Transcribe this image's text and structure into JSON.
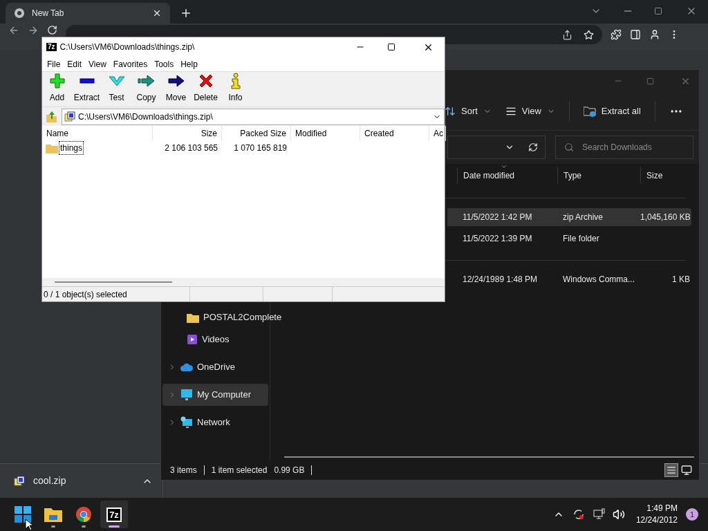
{
  "browser": {
    "tab": {
      "title": "New Tab"
    },
    "downloads": [
      {
        "name": "cool.zip"
      }
    ]
  },
  "explorer": {
    "toolbar": [
      {
        "label": "Sort",
        "kind": "sort"
      },
      {
        "label": "View",
        "kind": "view"
      },
      {
        "label": "Extract all",
        "kind": "extract"
      }
    ],
    "search": {
      "placeholder": "Search Downloads"
    },
    "columns": [
      "Date modified",
      "Type",
      "Size"
    ],
    "groups": [
      {
        "rows": [
          {
            "date": "11/5/2022 1:42 PM",
            "type": "zip Archive",
            "size": "1,045,160 KB",
            "selected": true
          },
          {
            "date": "11/5/2022 1:39 PM",
            "type": "File folder",
            "selected": false
          }
        ]
      },
      {
        "rows": [
          {
            "date": "12/24/1989 1:48 PM",
            "type": "Windows Comma...",
            "size": "1 KB",
            "selected": false
          }
        ]
      }
    ],
    "quick_access": [
      {
        "label": "POSTAL2Complete",
        "kind": "folder"
      },
      {
        "label": "Videos",
        "kind": "videos"
      }
    ],
    "locations": [
      {
        "label": "OneDrive",
        "kind": "cloud",
        "selected": false
      },
      {
        "label": "My Computer",
        "kind": "computer",
        "selected": true
      },
      {
        "label": "Network",
        "kind": "network",
        "selected": false
      }
    ],
    "status": {
      "count": "3 items",
      "selection": "1 item selected",
      "size": "0.99 GB"
    }
  },
  "sevenzip": {
    "badge": "7z",
    "title": "C:\\Users\\VM6\\Downloads\\things.zip\\",
    "menu": [
      "File",
      "Edit",
      "View",
      "Favorites",
      "Tools",
      "Help"
    ],
    "toolbar": [
      {
        "label": "Add",
        "kind": "add"
      },
      {
        "label": "Extract",
        "kind": "extract"
      },
      {
        "label": "Test",
        "kind": "test"
      },
      {
        "label": "Copy",
        "kind": "copy"
      },
      {
        "label": "Move",
        "kind": "move"
      },
      {
        "label": "Delete",
        "kind": "delete"
      },
      {
        "label": "Info",
        "kind": "info"
      }
    ],
    "path": "C:\\Users\\VM6\\Downloads\\things.zip\\",
    "columns": [
      "Name",
      "Size",
      "Packed Size",
      "Modified",
      "Created",
      "Ac"
    ],
    "rows": [
      {
        "name": "things",
        "size": "2 106 103 565",
        "packed": "1 070 165 819",
        "focused": true
      }
    ],
    "status": "0 / 1 object(s) selected"
  },
  "taskbar": {
    "apps": [
      {
        "kind": "start",
        "running": false,
        "active": false
      },
      {
        "kind": "explorer",
        "running": true,
        "active": false
      },
      {
        "kind": "chrome",
        "running": true,
        "active": false
      },
      {
        "kind": "sevenzip",
        "label": "7z",
        "running": true,
        "active": true
      }
    ],
    "time": "1:49 PM",
    "date": "12/24/2012",
    "notifications": "1"
  }
}
